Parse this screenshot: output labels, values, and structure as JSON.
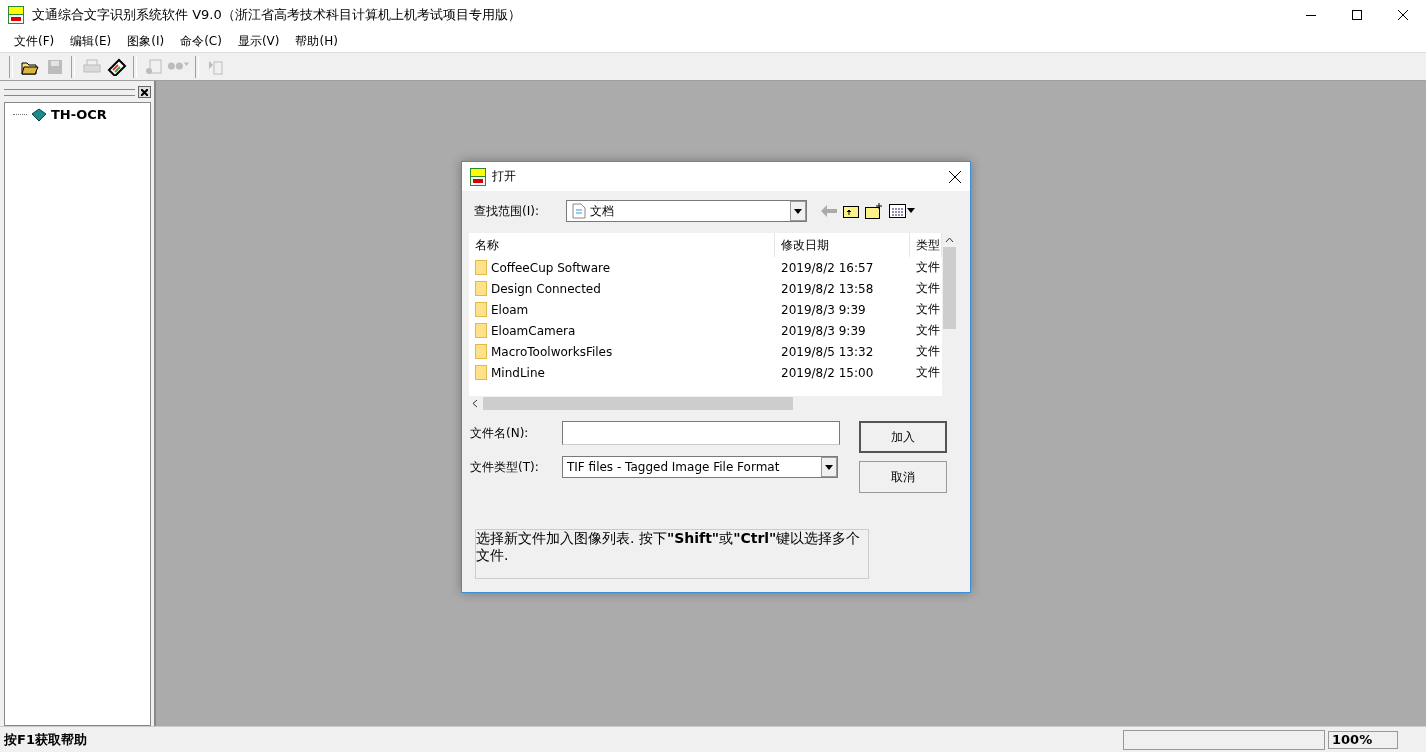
{
  "window": {
    "title": "文通综合文字识别系统软件 V9.0（浙江省高考技术科目计算机上机考试项目专用版）"
  },
  "menu": [
    "文件(F)",
    "编辑(E)",
    "图象(I)",
    "命令(C)",
    "显示(V)",
    "帮助(H)"
  ],
  "toolbar": [
    {
      "kind": "open",
      "disabled": false
    },
    {
      "kind": "save",
      "disabled": true
    },
    {
      "kind": "sep"
    },
    {
      "kind": "print",
      "disabled": true
    },
    {
      "kind": "scan",
      "disabled": false
    },
    {
      "kind": "sep"
    },
    {
      "kind": "recognize",
      "disabled": true
    },
    {
      "kind": "dropdown",
      "disabled": true
    },
    {
      "kind": "sep"
    },
    {
      "kind": "copy",
      "disabled": true
    }
  ],
  "tree": {
    "items": [
      {
        "label": "TH-OCR"
      }
    ]
  },
  "dialog": {
    "title": "打开",
    "look_in_label": "查找范围(I):",
    "look_in_value": "文档",
    "columns": [
      "名称",
      "修改日期",
      "类型"
    ],
    "rows": [
      {
        "name": "CoffeeCup Software",
        "date": "2019/8/2 16:57",
        "type": "文件"
      },
      {
        "name": "Design Connected",
        "date": "2019/8/2 13:58",
        "type": "文件"
      },
      {
        "name": "Eloam",
        "date": "2019/8/3 9:39",
        "type": "文件"
      },
      {
        "name": "EloamCamera",
        "date": "2019/8/3 9:39",
        "type": "文件"
      },
      {
        "name": "MacroToolworksFiles",
        "date": "2019/8/5 13:32",
        "type": "文件"
      },
      {
        "name": "MindLine",
        "date": "2019/8/2 15:00",
        "type": "文件"
      }
    ],
    "filename_label": "文件名(N):",
    "filetype_label": "文件类型(T):",
    "filetype_value": "TIF files - Tagged Image File Format",
    "buttons": [
      "加入",
      "取消"
    ],
    "hint": "选择新文件加入图像列表. 按下**\"Shift\"**或**\"Ctrl\"**键以选择多个文件."
  },
  "status_bar": {
    "text": "按F1获取帮助",
    "zoom": "100%"
  }
}
